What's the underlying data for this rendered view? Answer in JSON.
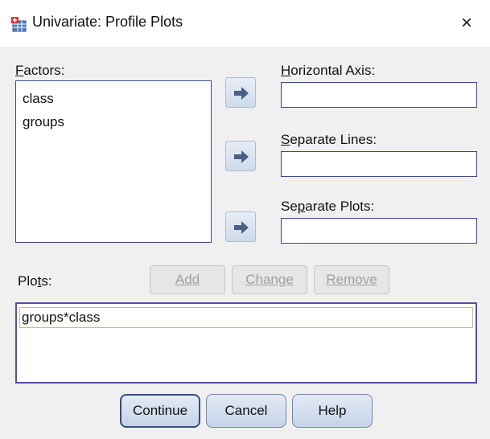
{
  "window": {
    "title": "Univariate: Profile Plots",
    "close_symbol": "×"
  },
  "factors": {
    "label": "Factors:",
    "items": [
      "class",
      "groups"
    ]
  },
  "horizontal_axis": {
    "label": "Horizontal Axis:",
    "value": ""
  },
  "separate_lines": {
    "label": "Separate Lines:",
    "value": ""
  },
  "separate_plots": {
    "label": "Separate Plots:",
    "value": ""
  },
  "plots": {
    "label": "Plots:",
    "items": [
      "groups*class"
    ],
    "add_label": "Add",
    "change_label": "Change",
    "remove_label": "Remove"
  },
  "buttons": {
    "continue": "Continue",
    "cancel": "Cancel",
    "help": "Help"
  },
  "icons": {
    "app": "spss-table-icon",
    "move": "move-right-arrow-icon",
    "close": "close-icon"
  }
}
